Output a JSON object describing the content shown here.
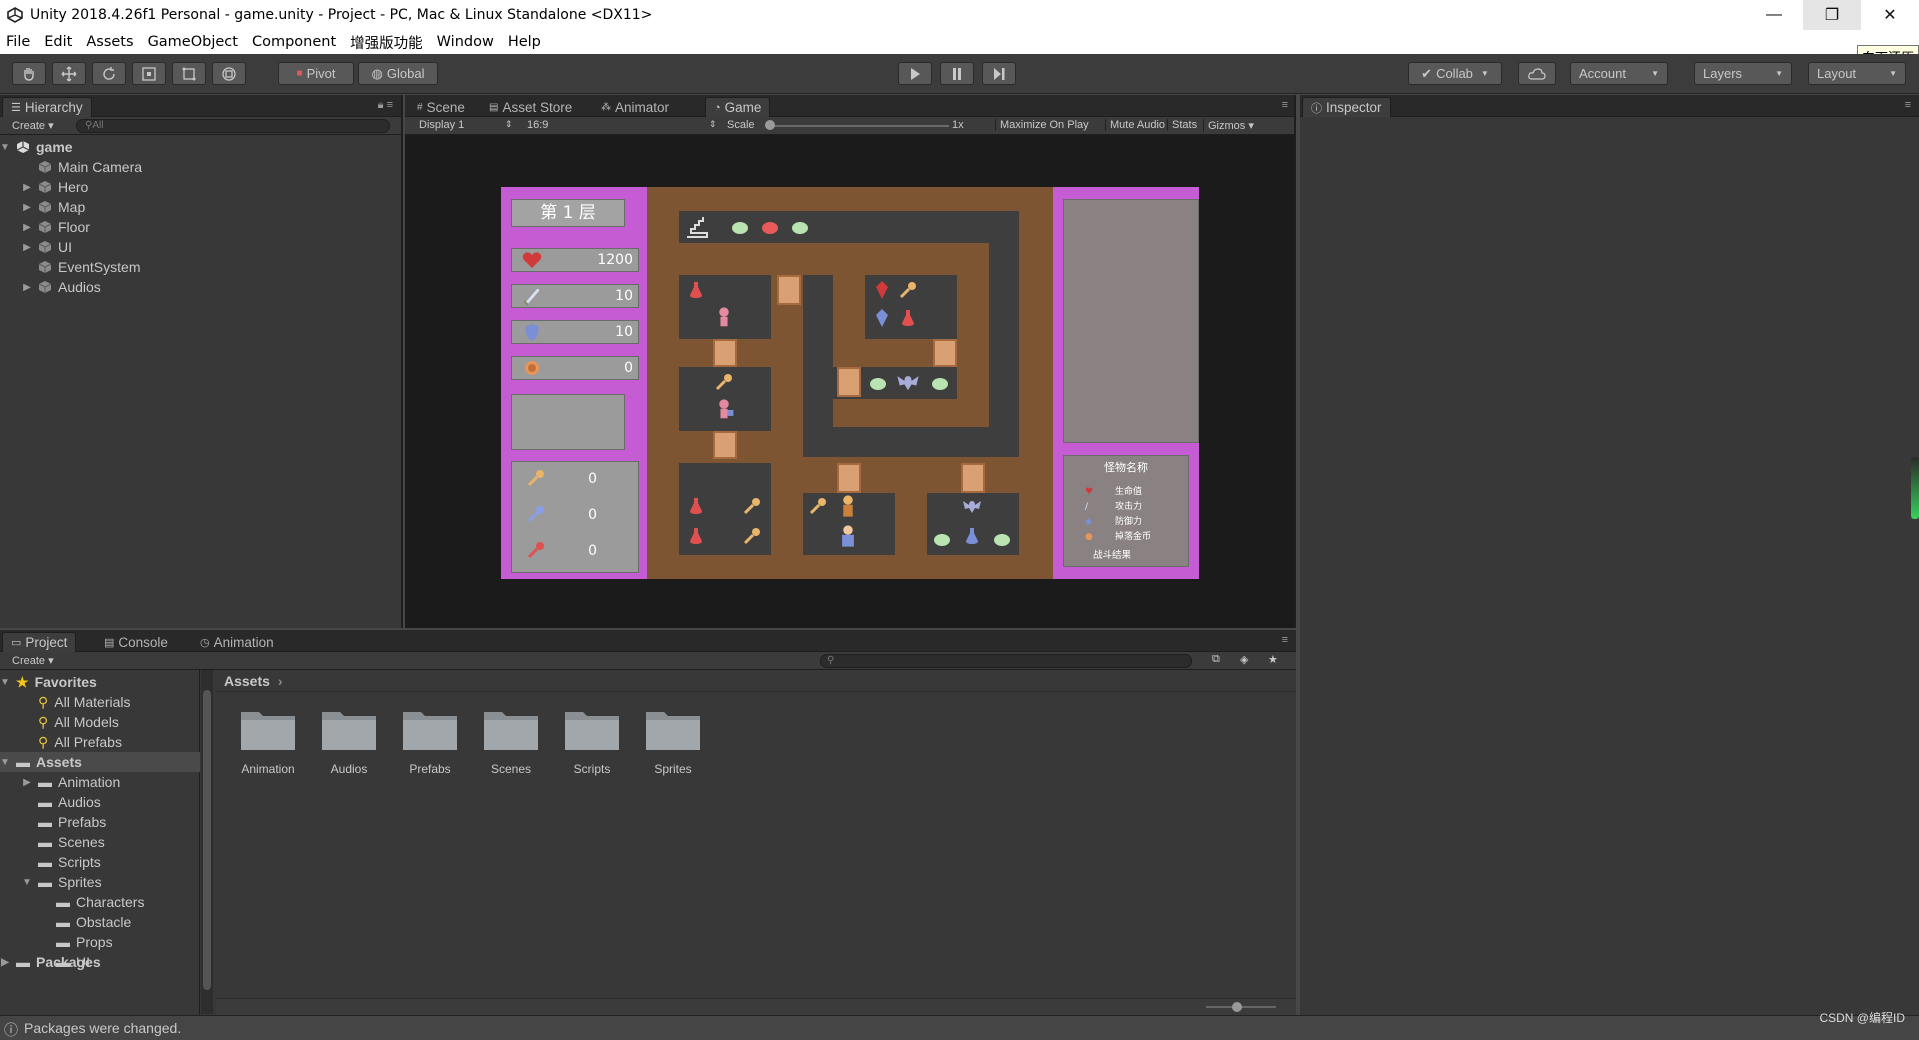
{
  "window": {
    "title": "Unity 2018.4.26f1 Personal - game.unity - Project - PC, Mac & Linux Standalone <DX11>",
    "tooltip": "向下还原"
  },
  "menu": [
    "File",
    "Edit",
    "Assets",
    "GameObject",
    "Component",
    "增强版功能",
    "Window",
    "Help"
  ],
  "toolbar": {
    "pivot": "Pivot",
    "global": "Global",
    "collab": "Collab",
    "account": "Account",
    "layers": "Layers",
    "layout": "Layout"
  },
  "hierarchy": {
    "tab": "Hierarchy",
    "create": "Create",
    "search_placeholder": "All",
    "scene": "game",
    "items": [
      "Main Camera",
      "Hero",
      "Map",
      "Floor",
      "UI",
      "EventSystem",
      "Audios"
    ]
  },
  "center_tabs": [
    "Scene",
    "Asset Store",
    "Animator",
    "Game"
  ],
  "game_toolbar": {
    "display": "Display 1",
    "aspect": "16:9",
    "scale_label": "Scale",
    "scale_value": "1x",
    "maximize": "Maximize On Play",
    "mute": "Mute Audio",
    "stats": "Stats",
    "gizmos": "Gizmos"
  },
  "game": {
    "floor_label": "第 1 层",
    "hp": "1200",
    "attack": "10",
    "defense": "10",
    "gold": "0",
    "yellow_keys": "0",
    "blue_keys": "0",
    "red_keys": "0",
    "monster_panel": {
      "title": "怪物名称",
      "hp": "生命值",
      "attack": "攻击力",
      "defense": "防御力",
      "gold": "掉落金币",
      "result": "战斗结果"
    }
  },
  "inspector": {
    "tab": "Inspector"
  },
  "project": {
    "tabs": [
      "Project",
      "Console",
      "Animation"
    ],
    "create": "Create",
    "favorites_label": "Favorites",
    "favorites": [
      "All Materials",
      "All Models",
      "All Prefabs"
    ],
    "assets_label": "Assets",
    "asset_folders": [
      "Animation",
      "Audios",
      "Prefabs",
      "Scenes",
      "Scripts"
    ],
    "sprites_label": "Sprites",
    "sprite_folders": [
      "Characters",
      "Obstacle",
      "Props",
      "UI"
    ],
    "packages_label": "Packages",
    "breadcrumb": "Assets",
    "grid_folders": [
      "Animation",
      "Audios",
      "Prefabs",
      "Scenes",
      "Scripts",
      "Sprites"
    ]
  },
  "status": {
    "message": "Packages were changed.",
    "watermark": "CSDN @编程ID"
  }
}
